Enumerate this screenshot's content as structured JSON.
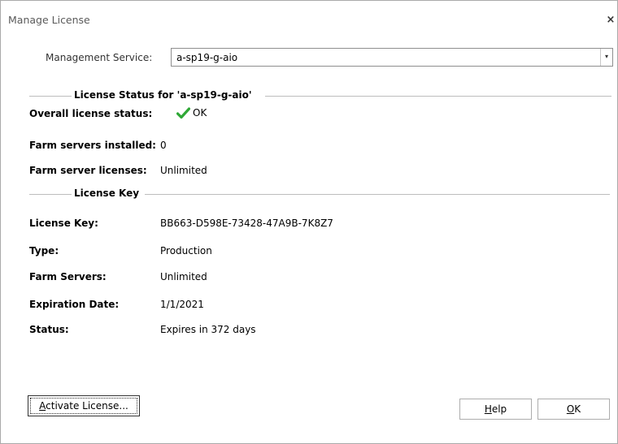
{
  "window": {
    "title": "Manage License",
    "close_glyph": "×"
  },
  "management_service": {
    "label": "Management Service:",
    "value": "a-sp19-g-aio",
    "arrow_glyph": "▾"
  },
  "license_status": {
    "section_title": "License Status for 'a-sp19-g-aio'",
    "overall_label": "Overall license status:",
    "overall_value": "OK",
    "overall_icon": "green-checkmark-icon",
    "installed_label": "Farm servers installed:",
    "installed_value": "0",
    "licenses_label": "Farm server licenses:",
    "licenses_value": "Unlimited"
  },
  "license_key": {
    "section_title": "License Key",
    "key_label": "License Key:",
    "key_value": "BB663-D598E-73428-47A9B-7K8Z7",
    "type_label": "Type:",
    "type_value": "Production",
    "farm_servers_label": "Farm Servers:",
    "farm_servers_value": "Unlimited",
    "expiration_label": "Expiration Date:",
    "expiration_value": "1/1/2021",
    "status_label": "Status:",
    "status_value": "Expires in 372 days"
  },
  "buttons": {
    "activate_mnemonic": "A",
    "activate_rest": "ctivate License...",
    "help_mnemonic": "H",
    "help_rest": "elp",
    "ok_mnemonic": "O",
    "ok_rest": "K"
  },
  "colors": {
    "check_green": "#2fa836",
    "section_line": "#bdbdbd",
    "title_text": "#5a5a5a"
  }
}
